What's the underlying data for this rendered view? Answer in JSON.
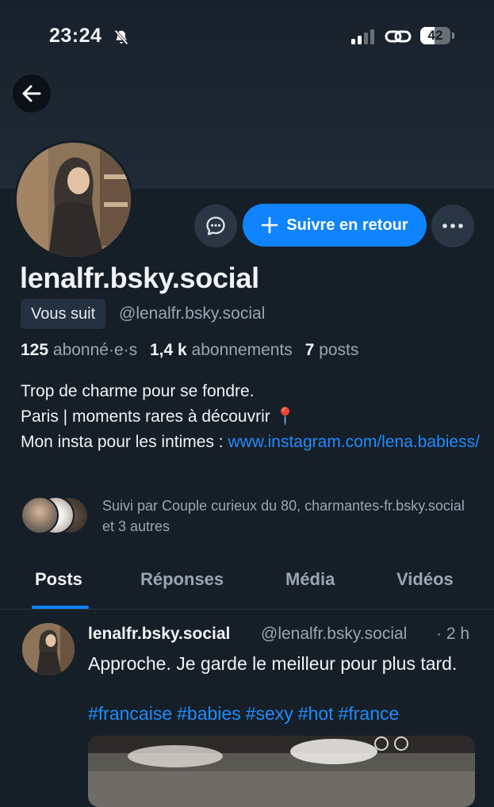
{
  "status_bar": {
    "time": "23:24",
    "battery": "42"
  },
  "profile": {
    "display_name": "lenalfr.bsky.social",
    "follows_you": "Vous suit",
    "handle": "@lenalfr.bsky.social",
    "stats": {
      "followers_count": "125",
      "followers_label": "abonné·e·s",
      "following_count": "1,4 k",
      "following_label": "abonnements",
      "posts_count": "7",
      "posts_label": "posts"
    },
    "bio": {
      "line1": "Trop de charme pour se fondre.",
      "line2": "Paris | moments rares à découvrir 📍",
      "line3_prefix": "Mon insta pour les intimes : ",
      "link": "www.instagram.com/lena.babiess/"
    },
    "followed_by": "Suivi par Couple curieux du 80, charmantes-fr.bsky.social et 3 autres"
  },
  "actions": {
    "follow_back": "Suivre en retour"
  },
  "tabs": [
    {
      "label": "Posts"
    },
    {
      "label": "Réponses"
    },
    {
      "label": "Média"
    },
    {
      "label": "Vidéos"
    }
  ],
  "post": {
    "author": "lenalfr.bsky.social",
    "handle": "@lenalfr.bsky.social",
    "time": "· 2 h",
    "text": "Approche. Je garde le meilleur pour plus tard.",
    "tags": [
      "#francaise",
      "#babies",
      "#sexy",
      "#hot",
      "#france"
    ]
  },
  "colors": {
    "accent": "#1083fe",
    "background": "#161e27",
    "link": "#1f8cff"
  }
}
